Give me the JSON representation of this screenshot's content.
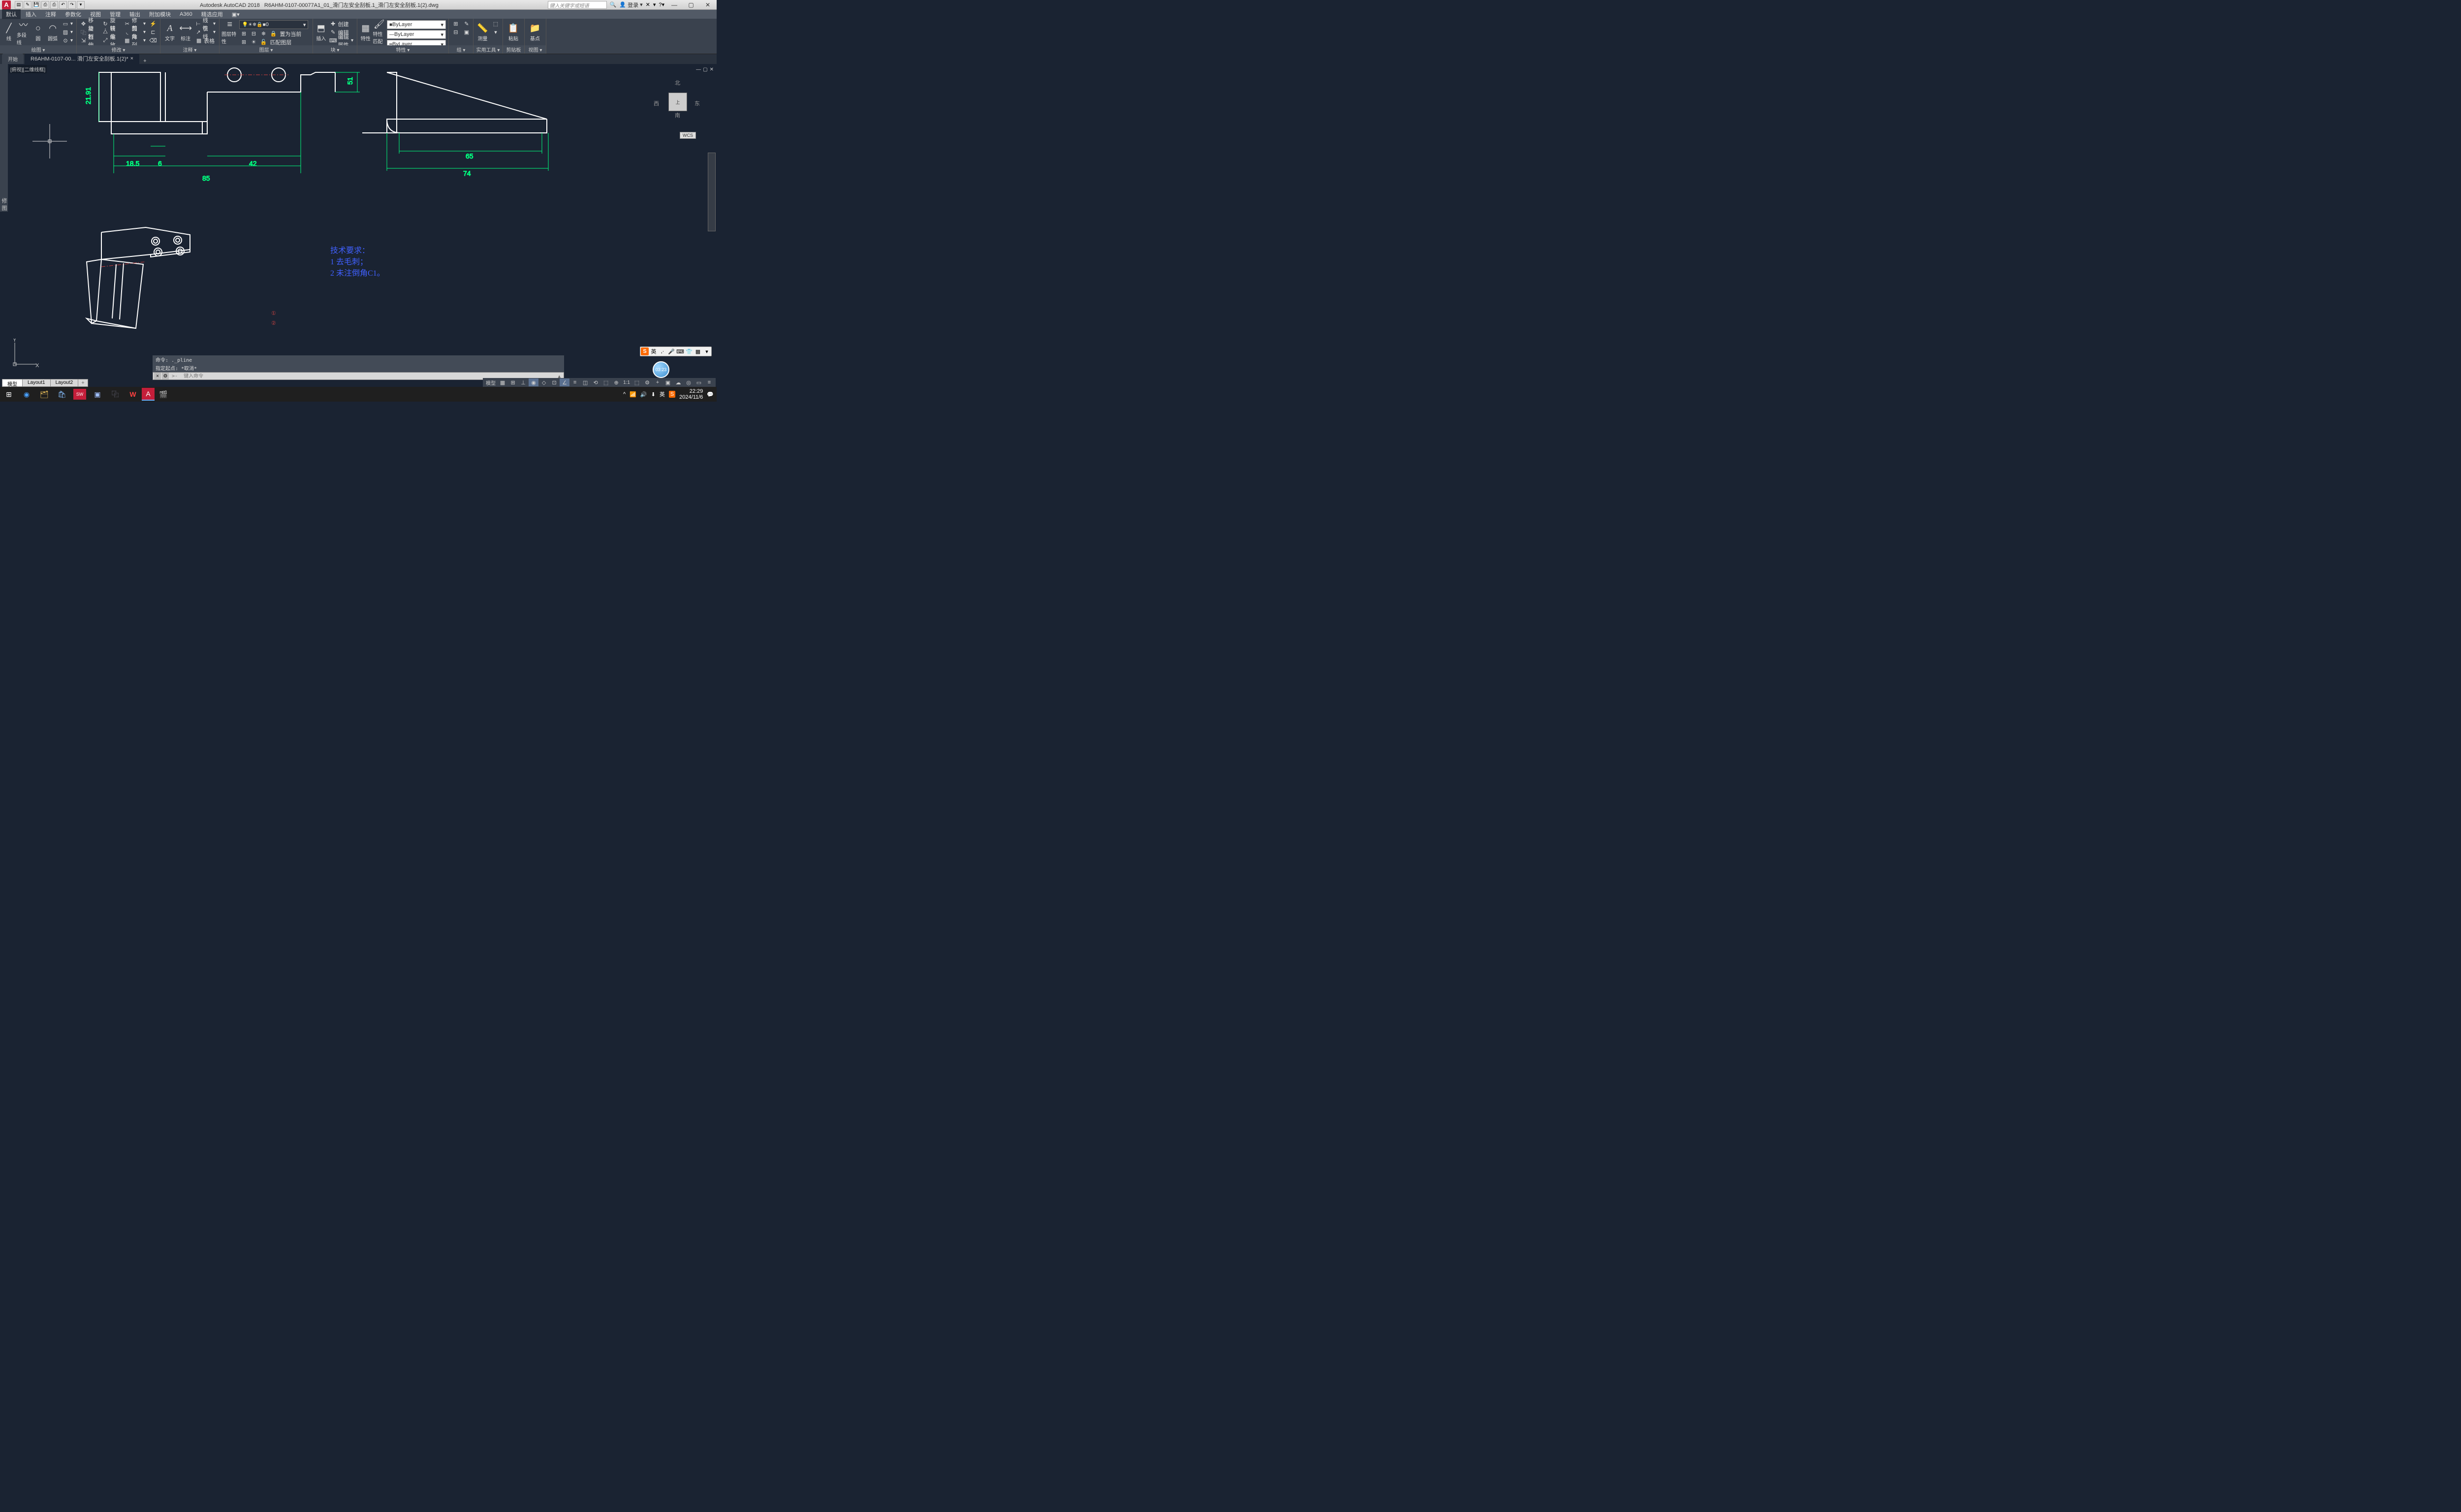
{
  "title": {
    "app": "Autodesk AutoCAD 2018",
    "file": "R6AHM-0107-00077A1_01_滑门左安全刮板.1_滑门左安全刮板.1(2).dwg"
  },
  "search_placeholder": "键入关键字或短语",
  "login": "登录",
  "menus": [
    "默认",
    "插入",
    "注释",
    "参数化",
    "视图",
    "管理",
    "输出",
    "附加模块",
    "A360",
    "精选应用"
  ],
  "ribbon": {
    "draw_label": "绘图 ▾",
    "modify_label": "修改 ▾",
    "anno_label": "注释 ▾",
    "layer_label": "图层 ▾",
    "block_label": "块 ▾",
    "prop_label": "特性 ▾",
    "group_label": "组 ▾",
    "util_label": "实用工具 ▾",
    "clip_label": "剪贴板",
    "view_label": "视图 ▾",
    "base_label": "基点",
    "pline": "多段线",
    "circle": "圆",
    "arc": "圆弧",
    "move": "移动",
    "rotate": "旋转",
    "trim": "修剪",
    "copy": "复制",
    "mirror": "镜像",
    "fillet": "圆角",
    "stretch": "拉伸",
    "scale": "缩放",
    "array": "阵列",
    "text": "文字",
    "dim": "标注",
    "table": "表格",
    "linear": "线性",
    "leader": "引线",
    "layerprop": "图层特性",
    "layer0": "0",
    "insert": "插入",
    "create": "创建",
    "edit": "编辑",
    "editattr": "编辑属性",
    "matchprop": "特性匹配",
    "props": "特性",
    "bylayer": "ByLayer",
    "measure": "测量",
    "paste": "粘贴",
    "front": "置为当前",
    "matchlayer": "匹配图层"
  },
  "tabs": {
    "start": "开始",
    "doc": "R6AHM-0107-00... 滑门左安全刮板.1(2)*"
  },
  "viewlabel": "[俯视][二维线框]",
  "viewcube": {
    "n": "北",
    "s": "南",
    "e": "东",
    "w": "西",
    "top": "上",
    "wcs": "WCS"
  },
  "dims": {
    "d1": "21.91",
    "d2": "18.5",
    "d3": "6",
    "d4": "42",
    "d5": "85",
    "d6": "51",
    "d7": "65",
    "d8": "74"
  },
  "notes": {
    "t1": "技术要求：",
    "t2": "1  去毛刺；",
    "t3": "2  未注倒角C1。"
  },
  "revmark": {
    "a": "①",
    "b": "②"
  },
  "cmd": {
    "hist1": "命令: ._pline",
    "hist2": "指定起点: *取消*",
    "prompt": ">-  键入命令"
  },
  "layouts": {
    "model": "模型",
    "l1": "Layout1",
    "l2": "Layout2"
  },
  "status": {
    "model": "模型",
    "scale": "1:1"
  },
  "ime": {
    "lang": "英",
    "punct": ",·"
  },
  "tray": {
    "ime": "英",
    "time": "22:29",
    "date": "2024/11/6"
  },
  "chat": "03:23"
}
